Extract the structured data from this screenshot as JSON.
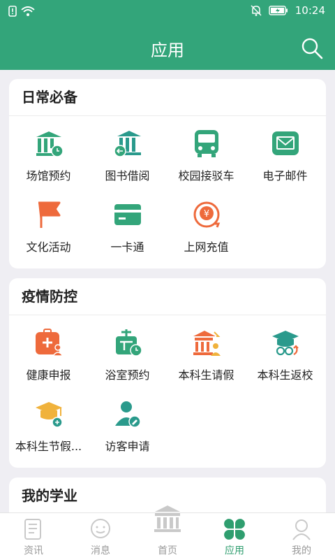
{
  "status": {
    "time": "10:24"
  },
  "header": {
    "title": "应用"
  },
  "sections": [
    {
      "title": "日常必备",
      "items": [
        {
          "label": "场馆预约",
          "icon": "venue-booking-icon"
        },
        {
          "label": "图书借阅",
          "icon": "library-borrow-icon"
        },
        {
          "label": "校园接驳车",
          "icon": "shuttle-bus-icon"
        },
        {
          "label": "电子邮件",
          "icon": "email-icon"
        },
        {
          "label": "文化活动",
          "icon": "flag-icon"
        },
        {
          "label": "一卡通",
          "icon": "card-icon"
        },
        {
          "label": "上网充值",
          "icon": "recharge-icon"
        }
      ]
    },
    {
      "title": "疫情防控",
      "items": [
        {
          "label": "健康申报",
          "icon": "health-report-icon"
        },
        {
          "label": "浴室预约",
          "icon": "bathroom-booking-icon"
        },
        {
          "label": "本科生请假",
          "icon": "leave-request-icon"
        },
        {
          "label": "本科生返校",
          "icon": "return-school-icon"
        },
        {
          "label": "本科生节假...",
          "icon": "holiday-icon"
        },
        {
          "label": "访客申请",
          "icon": "visitor-icon"
        }
      ]
    },
    {
      "title": "我的学业",
      "items": []
    }
  ],
  "tabs": [
    {
      "label": "资讯",
      "icon": "news-icon"
    },
    {
      "label": "消息",
      "icon": "message-icon"
    },
    {
      "label": "首页",
      "icon": "home-building-icon"
    },
    {
      "label": "应用",
      "icon": "apps-clover-icon"
    },
    {
      "label": "我的",
      "icon": "profile-icon"
    }
  ],
  "colors": {
    "primary": "#33a57a",
    "orange": "#ee6a3c",
    "yellow": "#f0b23c",
    "teal": "#2a9a8c"
  }
}
